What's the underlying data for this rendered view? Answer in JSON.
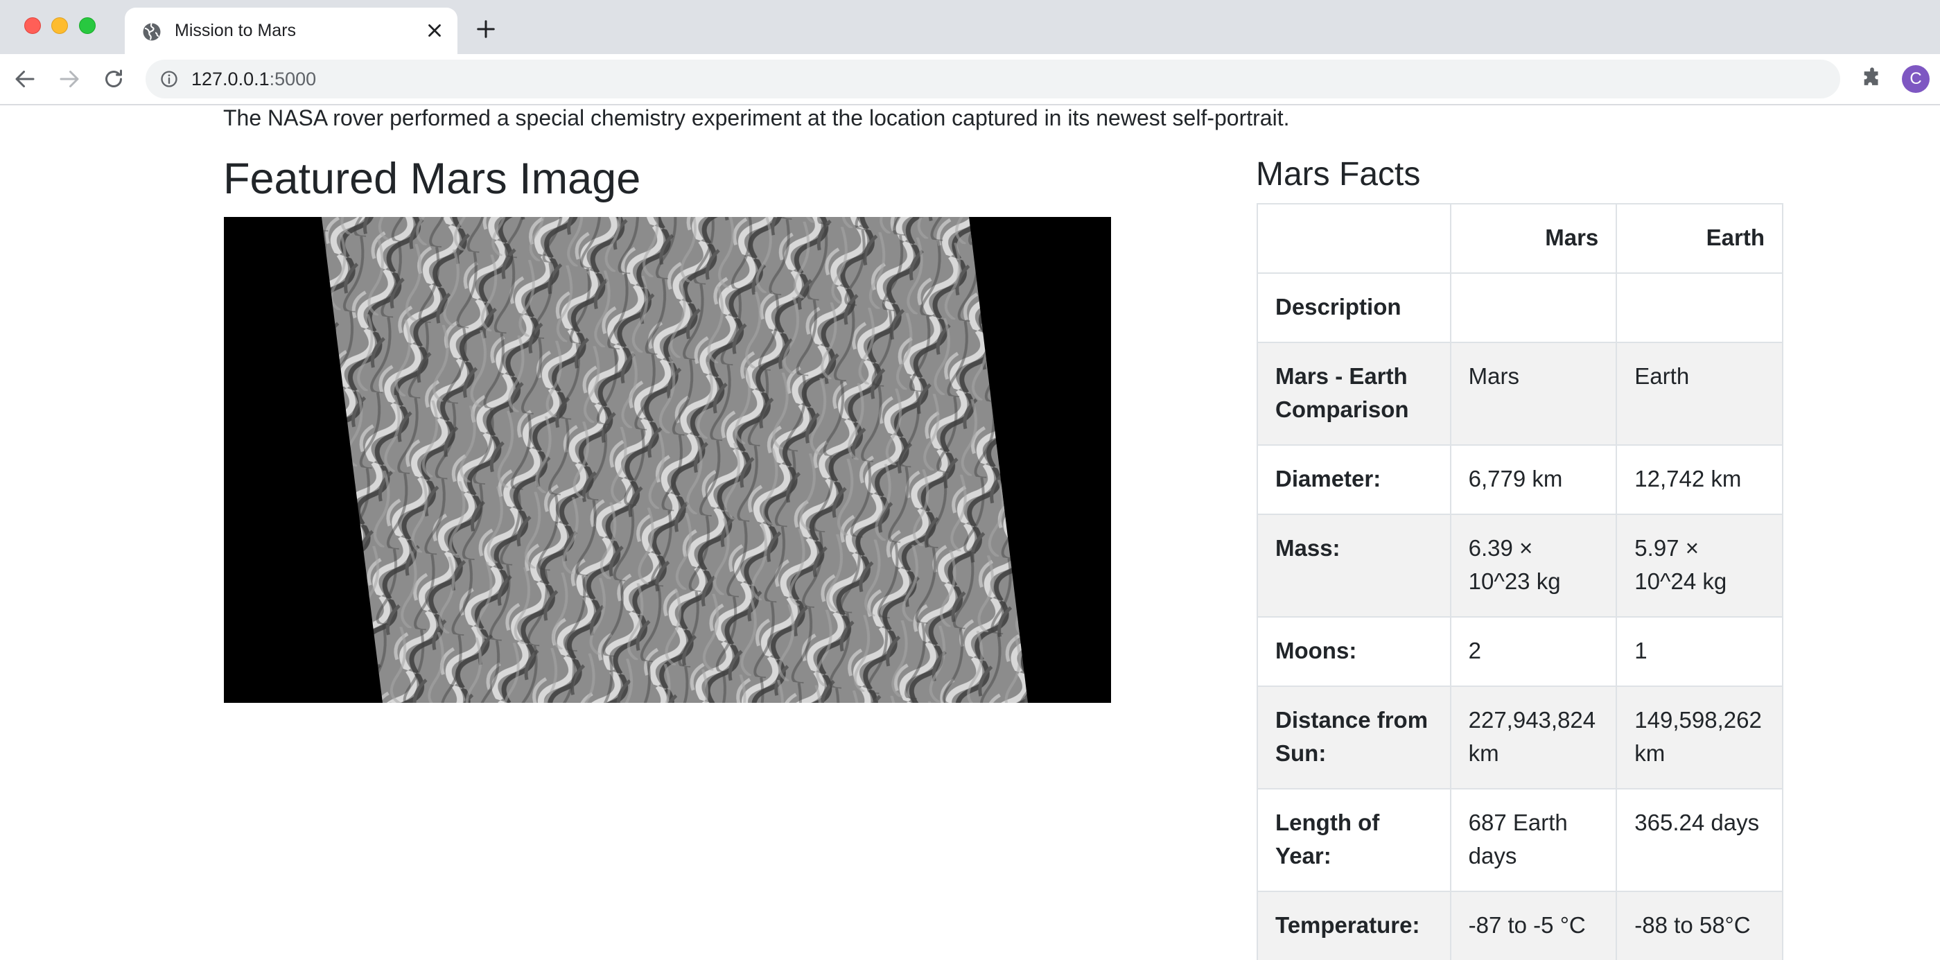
{
  "browser": {
    "tab_title": "Mission to Mars",
    "url_host": "127.0.0.1",
    "url_port": ":5000",
    "profile_initial": "C"
  },
  "news": {
    "paragraph": "The NASA rover performed a special chemistry experiment at the location captured in its newest self-portrait."
  },
  "featured": {
    "heading": "Featured Mars Image",
    "image_alt": "Mars dunes grayscale image"
  },
  "facts": {
    "heading": "Mars Facts",
    "columns": [
      "",
      "Mars",
      "Earth"
    ],
    "rows": [
      {
        "label": "Description",
        "mars": "",
        "earth": ""
      },
      {
        "label": "Mars - Earth Comparison",
        "mars": "Mars",
        "earth": "Earth"
      },
      {
        "label": "Diameter:",
        "mars": "6,779 km",
        "earth": "12,742 km"
      },
      {
        "label": "Mass:",
        "mars": "6.39 × 10^23 kg",
        "earth": "5.97 × 10^24 kg"
      },
      {
        "label": "Moons:",
        "mars": "2",
        "earth": "1"
      },
      {
        "label": "Distance from Sun:",
        "mars": "227,943,824 km",
        "earth": "149,598,262 km"
      },
      {
        "label": "Length of Year:",
        "mars": "687 Earth days",
        "earth": "365.24 days"
      },
      {
        "label": "Temperature:",
        "mars": "-87 to -5 °C",
        "earth": "-88 to 58°C"
      }
    ]
  }
}
